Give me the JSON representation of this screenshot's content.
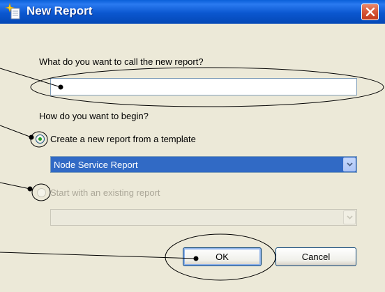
{
  "window": {
    "title": "New Report",
    "icon": "new-report-sparkle-icon",
    "close_icon": "close-x-icon"
  },
  "name_prompt": {
    "label": "What do you want to call the new report?",
    "value": ""
  },
  "begin_prompt": {
    "label": "How do you want to begin?"
  },
  "option_template": {
    "label": "Create a new report from a template",
    "checked": true,
    "selected_value": "Node Service Report"
  },
  "option_existing": {
    "label": "Start with an existing report",
    "checked": false,
    "enabled": false,
    "selected_value": ""
  },
  "buttons": {
    "ok": "OK",
    "cancel": "Cancel"
  },
  "colors": {
    "titlebar": "#0b57d0",
    "dialog_bg": "#ece9d8",
    "selection": "#316ac5",
    "close_button": "#d65638",
    "radio_dot": "#21a121"
  }
}
